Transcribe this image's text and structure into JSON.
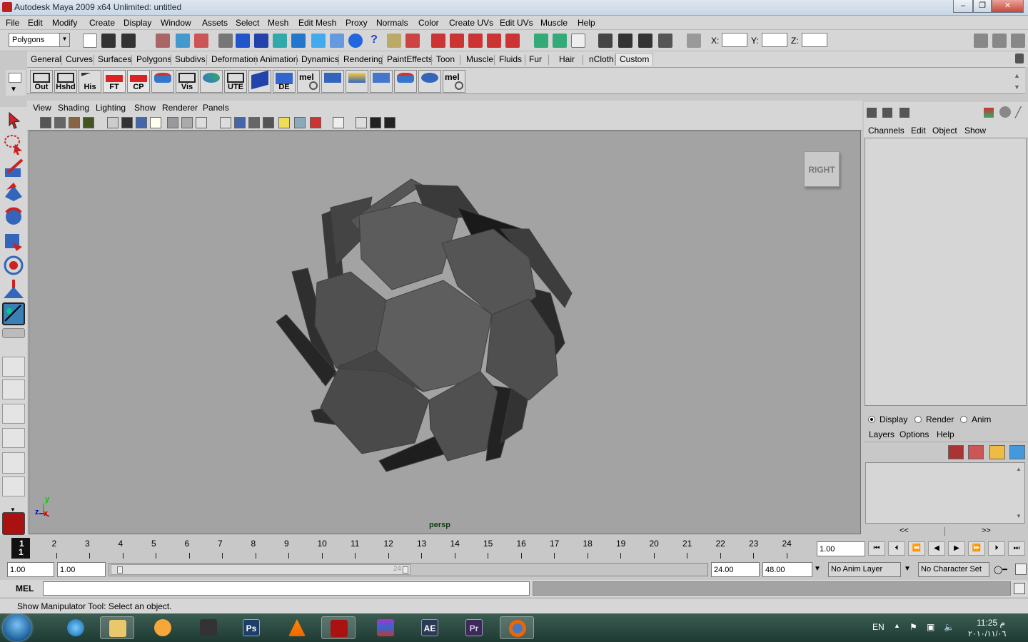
{
  "window": {
    "title": "Autodesk Maya 2009 x64 Unlimited: untitled"
  },
  "menubar": [
    "File",
    "Edit",
    "Modify",
    "Create",
    "Display",
    "Window",
    "Assets",
    "Select",
    "Mesh",
    "Edit Mesh",
    "Proxy",
    "Normals",
    "Color",
    "Create UVs",
    "Edit UVs",
    "Muscle",
    "Help"
  ],
  "statusline": {
    "menu_set": "Polygons",
    "x_label": "X:",
    "y_label": "Y:",
    "z_label": "Z:",
    "x_value": "",
    "y_value": "",
    "z_value": ""
  },
  "shelf": {
    "tabs": [
      "General",
      "Curves",
      "Surfaces",
      "Polygons",
      "Subdivs",
      "Deformation",
      "Animation",
      "Dynamics",
      "Rendering",
      "PaintEffects",
      "Toon",
      "Muscle",
      "Fluids",
      "Fur",
      "Hair",
      "nCloth",
      "Custom"
    ],
    "active_tab": "Custom",
    "buttons": [
      "Out",
      "Hshd",
      "His",
      "FT",
      "CP",
      "",
      "Vis",
      "",
      "UTE",
      "",
      "DE",
      "mel",
      "",
      "",
      "",
      "",
      "",
      "mel"
    ]
  },
  "panel": {
    "menus": [
      "View",
      "Shading",
      "Lighting",
      "Show",
      "Renderer",
      "Panels"
    ],
    "viewcube_label": "RIGHT",
    "camera": "persp",
    "axis_x": "x",
    "axis_y": "y",
    "axis_z": "z"
  },
  "channel_box": {
    "menus": [
      "Channels",
      "Edit",
      "Object",
      "Show"
    ]
  },
  "layer_editor": {
    "modes": [
      "Display",
      "Render",
      "Anim"
    ],
    "selected_mode": "Display",
    "menus": [
      "Layers",
      "Options",
      "Help"
    ],
    "scroll_left": "<<",
    "scroll_right": ">>"
  },
  "time_slider": {
    "current_frame": "1",
    "ticks": [
      "1",
      "2",
      "3",
      "4",
      "5",
      "6",
      "7",
      "8",
      "9",
      "10",
      "11",
      "12",
      "13",
      "14",
      "15",
      "16",
      "17",
      "18",
      "19",
      "20",
      "21",
      "22",
      "23",
      "24"
    ],
    "current_time_field": "1.00"
  },
  "range_slider": {
    "start_time": "1.00",
    "playback_start": "1.00",
    "range_marker": "24",
    "playback_end": "24.00",
    "end_time": "48.00",
    "anim_layer": "No Anim Layer",
    "character_set": "No Character Set"
  },
  "command_line": {
    "label": "MEL",
    "value": ""
  },
  "help_line": {
    "text": "Show Manipulator Tool: Select an object."
  },
  "taskbar": {
    "apps": [
      "Internet Explorer",
      "Windows Explorer",
      "Media Player",
      "Wacom",
      "Photoshop",
      "VLC",
      "Maya",
      "WinRAR",
      "After Effects",
      "Premiere",
      "Firefox"
    ],
    "ps_label": "Ps",
    "ae_label": "AE",
    "pr_label": "Pr",
    "language": "EN",
    "time": "11:25 م",
    "date": "٢٠١٠/١١/٠٦"
  },
  "colors": {
    "viewport_bg": "#a3a3a3",
    "ui_bg": "#d6d6d6",
    "mesh_face": "#5a5a5a",
    "camera_label": "#0b3d0b"
  }
}
